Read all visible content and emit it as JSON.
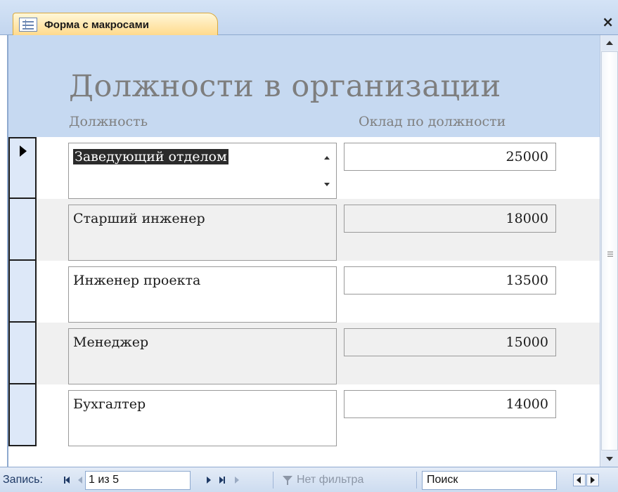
{
  "tab": {
    "label": "Форма с макросами",
    "icon": "form-icon",
    "close_label": "×"
  },
  "form": {
    "title": "Должности в организации",
    "columns": {
      "position": "Должность",
      "salary": "Оклад по должности"
    }
  },
  "records": [
    {
      "position": "Заведующий отделом",
      "salary": "25000"
    },
    {
      "position": "Старший инженер",
      "salary": "18000"
    },
    {
      "position": "Инженер проекта",
      "salary": "13500"
    },
    {
      "position": "Менеджер",
      "salary": "15000"
    },
    {
      "position": "Бухгалтер",
      "salary": "14000"
    }
  ],
  "navigation": {
    "record_label": "Запись:",
    "current": "1 из 5",
    "filter_label": "Нет фильтра",
    "search_placeholder": "Поиск"
  },
  "colors": {
    "header_bg": "#c6d9f1",
    "tab_bg": "#ffd98a",
    "label_text": "#7e7e7e",
    "alt_row": "#f0f0f0"
  }
}
